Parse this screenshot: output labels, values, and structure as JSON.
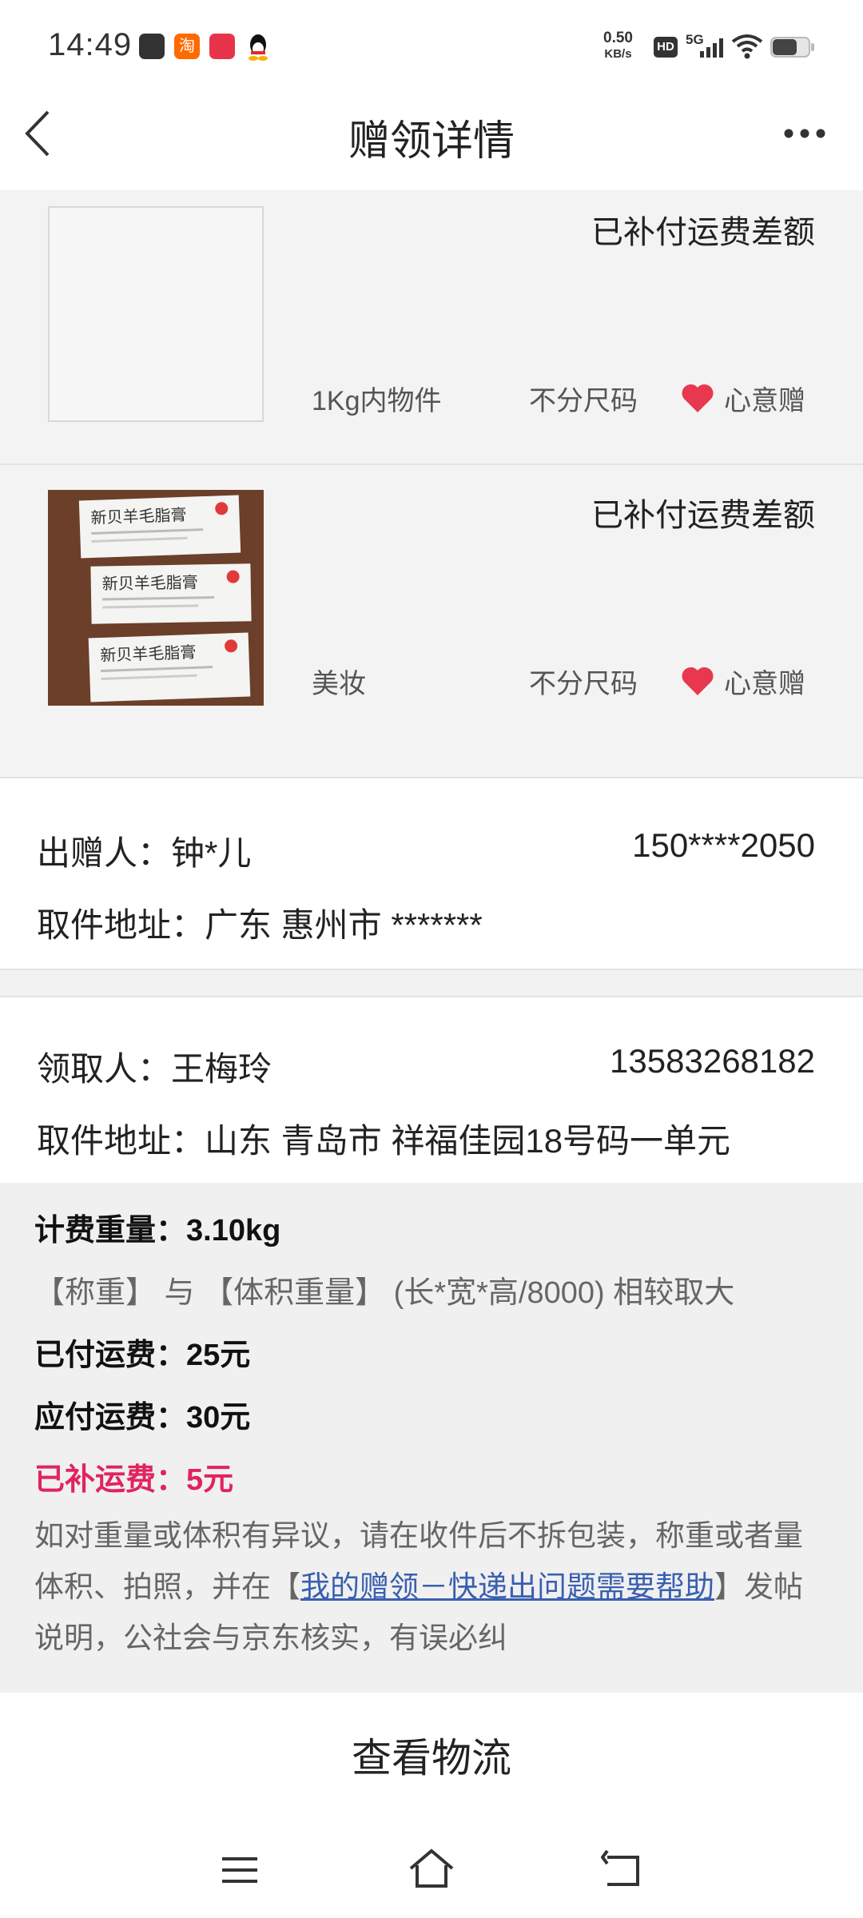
{
  "status_bar": {
    "time": "14:49",
    "net_speed_value": "0.50",
    "net_speed_unit": "KB/s",
    "hd_label": "HD",
    "signal_label": "5G"
  },
  "nav": {
    "title": "赠领详情"
  },
  "items": [
    {
      "status": "已补付运费差额",
      "category": "1Kg内物件",
      "size": "不分尺码",
      "tag": "心意赠"
    },
    {
      "status": "已补付运费差额",
      "category": "美妆",
      "size": "不分尺码",
      "tag": "心意赠",
      "image_text": "新贝羊毛脂膏"
    }
  ],
  "giver": {
    "label": "出赠人：钟*儿",
    "phone": "150****2050",
    "address": "取件地址：广东 惠州市 *******"
  },
  "receiver": {
    "label": "领取人：王梅玲",
    "phone": "13583268182",
    "address": "取件地址：山东 青岛市 祥福佳园18号码一单元"
  },
  "fee": {
    "weight": "计费重量：3.10kg",
    "weight_note": "【称重】 与 【体积重量】 (长*宽*高/8000) 相较取大",
    "paid": "已付运费：25元",
    "due": "应付运费：30元",
    "supplement": "已补运费：5元",
    "notice_prefix": "如对重量或体积有异议，请在收件后不拆包装，称重或者量体积、拍照，并在【",
    "notice_link": "我的赠领－快递出问题需要帮助",
    "notice_suffix": "】发帖说明，公社会与京东核实，有误必纠"
  },
  "actions": {
    "logistics": "查看物流"
  },
  "colors": {
    "accent_red": "#e0245e",
    "heart": "#e8384f",
    "link": "#3a5fb0"
  }
}
